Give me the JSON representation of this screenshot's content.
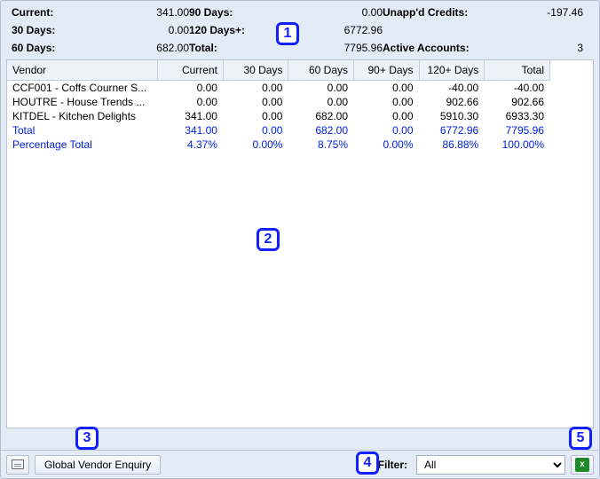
{
  "summary": {
    "current_label": "Current:",
    "current_val": "341.00",
    "d30_label": "30 Days:",
    "d30_val": "0.00",
    "d60_label": "60 Days:",
    "d60_val": "682.00",
    "d90_label": "90 Days:",
    "d90_val": "0.00",
    "d120_label": "120 Days+:",
    "d120_val": "6772.96",
    "total_label": "Total:",
    "total_val": "7795.96",
    "unapp_label": "Unapp'd Credits:",
    "unapp_val": "-197.46",
    "active_label": "Active Accounts:",
    "active_val": "3"
  },
  "columns": [
    "Vendor",
    "Current",
    "30 Days",
    "60 Days",
    "90+ Days",
    "120+ Days",
    "Total"
  ],
  "rows": [
    {
      "vendor": "CCF001 - Coffs Courner S...",
      "c": "0.00",
      "d30": "0.00",
      "d60": "0.00",
      "d90": "0.00",
      "d120": "-40.00",
      "tot": "-40.00"
    },
    {
      "vendor": "HOUTRE - House Trends ...",
      "c": "0.00",
      "d30": "0.00",
      "d60": "0.00",
      "d90": "0.00",
      "d120": "902.66",
      "tot": "902.66"
    },
    {
      "vendor": "KITDEL - Kitchen Delights",
      "c": "341.00",
      "d30": "0.00",
      "d60": "682.00",
      "d90": "0.00",
      "d120": "5910.30",
      "tot": "6933.30"
    }
  ],
  "totals_row": {
    "vendor": "Total",
    "c": "341.00",
    "d30": "0.00",
    "d60": "682.00",
    "d90": "0.00",
    "d120": "6772.96",
    "tot": "7795.96"
  },
  "percent_row": {
    "vendor": "Percentage Total",
    "c": "4.37%",
    "d30": "0.00%",
    "d60": "8.75%",
    "d90": "0.00%",
    "d120": "86.88%",
    "tot": "100.00%"
  },
  "footer": {
    "enquiry_label": "Global Vendor Enquiry",
    "filter_label": "Filter:",
    "filter_value": "All"
  },
  "markers": {
    "1": "1",
    "2": "2",
    "3": "3",
    "4": "4",
    "5": "5"
  }
}
